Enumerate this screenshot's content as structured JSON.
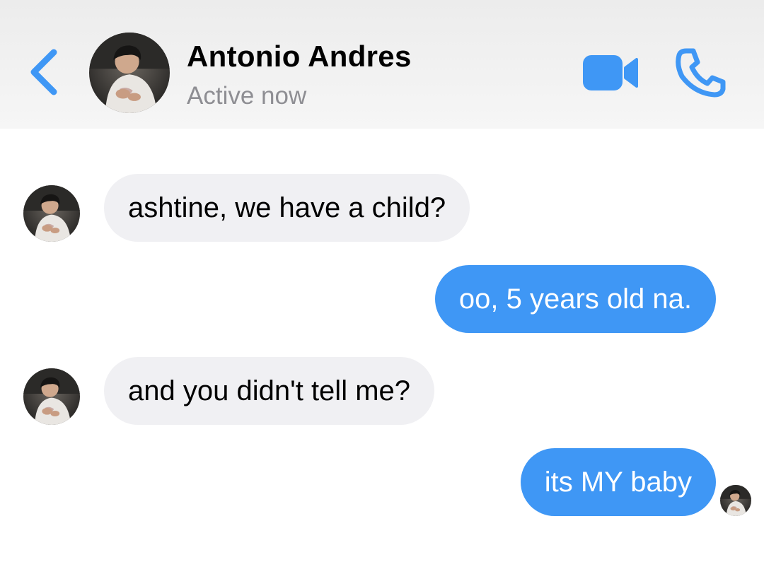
{
  "header": {
    "name": "Antonio Andres",
    "status": "Active now",
    "back_icon": "chevron-left-icon",
    "video_icon": "video-camera-icon",
    "phone_icon": "phone-icon"
  },
  "colors": {
    "accent": "#3f97f5",
    "incoming_bubble": "#f0f0f3",
    "status_text": "#8e8e93",
    "header_bg": "#f2f2f2"
  },
  "messages": [
    {
      "direction": "incoming",
      "text": "ashtine, we have a child?"
    },
    {
      "direction": "outgoing",
      "text": "oo, 5 years old na."
    },
    {
      "direction": "incoming",
      "text": "and you didn't tell me?"
    },
    {
      "direction": "outgoing",
      "text": "its MY baby"
    }
  ]
}
